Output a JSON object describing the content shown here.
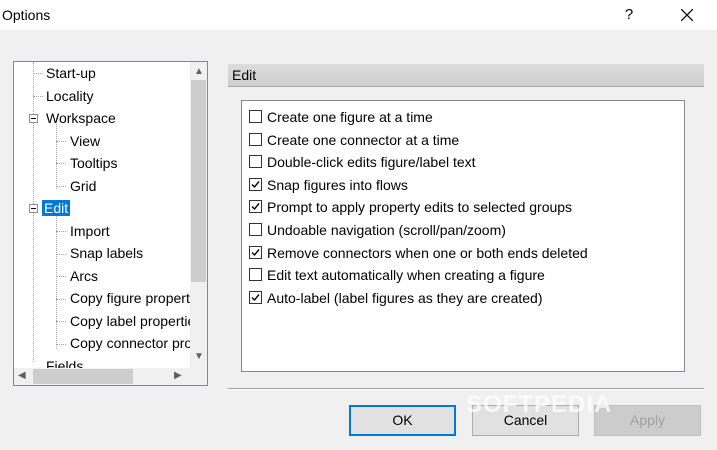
{
  "window": {
    "title": "Options",
    "help_label": "?"
  },
  "tree": {
    "items": [
      {
        "label": "Start-up"
      },
      {
        "label": "Locality"
      },
      {
        "label": "Workspace"
      },
      {
        "label": "View"
      },
      {
        "label": "Tooltips"
      },
      {
        "label": "Grid"
      },
      {
        "label": "Edit"
      },
      {
        "label": "Import"
      },
      {
        "label": "Snap labels"
      },
      {
        "label": "Arcs"
      },
      {
        "label": "Copy figure properties"
      },
      {
        "label": "Copy label properties"
      },
      {
        "label": "Copy connector properties"
      },
      {
        "label": "Fields"
      }
    ],
    "selected": "Edit"
  },
  "section": {
    "title": "Edit"
  },
  "options": [
    {
      "label": "Create one figure at a time",
      "checked": false
    },
    {
      "label": "Create one connector at a time",
      "checked": false
    },
    {
      "label": "Double-click edits figure/label text",
      "checked": false
    },
    {
      "label": "Snap figures into flows",
      "checked": true
    },
    {
      "label": "Prompt to apply property edits to selected groups",
      "checked": true
    },
    {
      "label": "Undoable navigation (scroll/pan/zoom)",
      "checked": false
    },
    {
      "label": "Remove connectors when one or both ends deleted",
      "checked": true
    },
    {
      "label": "Edit text automatically when creating a figure",
      "checked": false
    },
    {
      "label": "Auto-label (label figures as they are created)",
      "checked": true
    }
  ],
  "buttons": {
    "ok": "OK",
    "cancel": "Cancel",
    "apply": "Apply"
  },
  "watermark": "SOFTPEDIA"
}
